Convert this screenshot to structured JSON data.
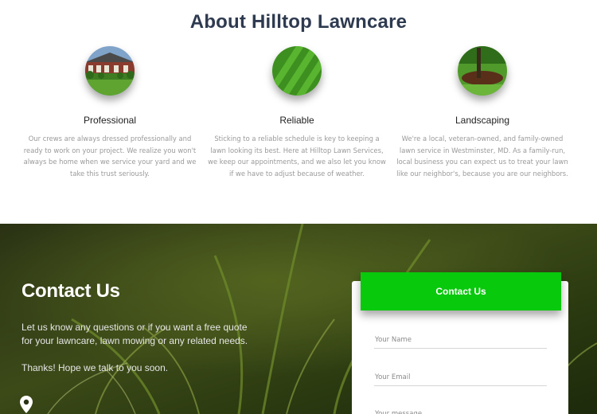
{
  "about": {
    "title": "About Hilltop Lawncare",
    "features": [
      {
        "icon": "house-lawn-image",
        "title": "Professional",
        "text": "Our crews are always dressed professionally and ready to work on your project. We realize you won't always be home when we service your yard and we take this trust seriously."
      },
      {
        "icon": "striped-lawn-image",
        "title": "Reliable",
        "text": "Sticking to a reliable schedule is key to keeping a lawn looking its best. Here at Hilltop Lawn Services, we keep our appointments, and we also let you know if we have to adjust because of weather."
      },
      {
        "icon": "tree-mulch-image",
        "title": "Landscaping",
        "text": "We're a local, veteran-owned, and family-owned lawn service in Westminster, MD. As a family-run, local business you can expect us to treat your lawn like our neighbor's, because you are our neighbors."
      }
    ]
  },
  "contact": {
    "heading": "Contact Us",
    "paragraph1": "Let us know any questions or if you want a free quote for your lawncare, lawn mowing or any related needs.",
    "paragraph2": "Thanks! Hope we talk to you soon.",
    "location_icon": "map-pin-icon",
    "form": {
      "header": "Contact Us",
      "name_placeholder": "Your Name",
      "email_placeholder": "Your Email",
      "message_placeholder": "Your message"
    }
  },
  "colors": {
    "title": "#2e3a4f",
    "accent_green": "#08c90c",
    "muted_text": "#9a9a9a"
  }
}
